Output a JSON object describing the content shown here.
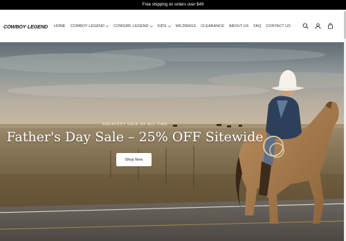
{
  "announcement": "Free shipping on orders over $49",
  "logo": {
    "part1": "COWBOY",
    "part2": "LEGEND"
  },
  "nav": [
    {
      "label": "HOME",
      "dropdown": false
    },
    {
      "label": "COWBOY LEGEND",
      "dropdown": true
    },
    {
      "label": "COWGIRL LEGEND",
      "dropdown": true
    },
    {
      "label": "KIDS",
      "dropdown": true
    },
    {
      "label": "WILDRAGS",
      "dropdown": false
    },
    {
      "label": "CLEARANCE",
      "dropdown": false
    },
    {
      "label": "ABOUT US",
      "dropdown": false
    },
    {
      "label": "FAQ",
      "dropdown": false
    },
    {
      "label": "CONTACT US",
      "dropdown": false
    }
  ],
  "header_icons": [
    "search-icon",
    "account-icon",
    "cart-icon"
  ],
  "hero": {
    "eyebrow": "GREATEST SALE OF ALL TIME",
    "title": "Father's Day Sale – 25% OFF Sitewide",
    "button_label": "Shop Now"
  }
}
